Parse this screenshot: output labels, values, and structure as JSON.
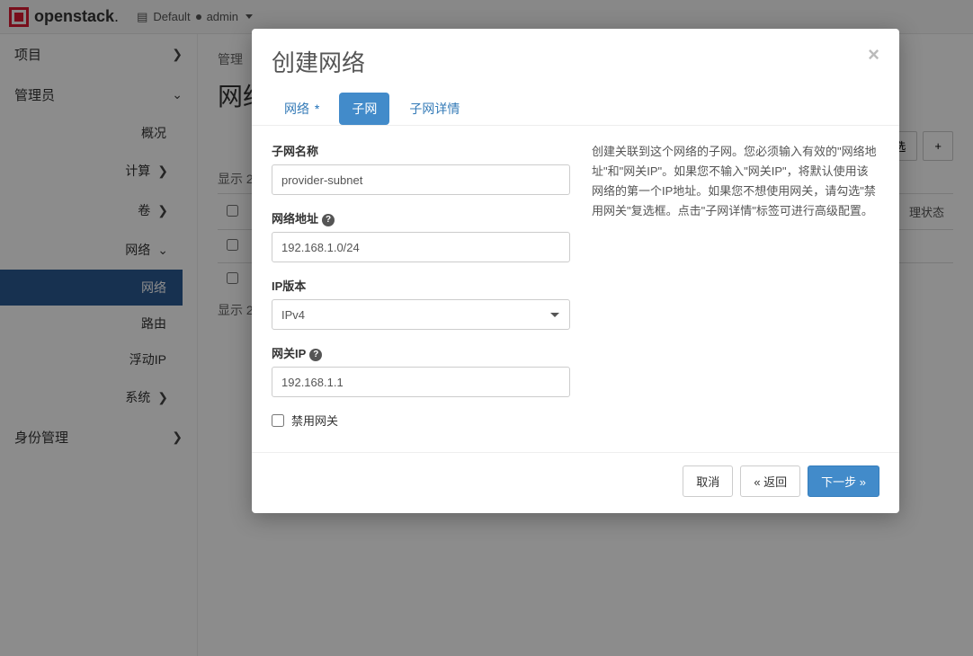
{
  "topbar": {
    "brand": "openstack",
    "domain_label": "Default",
    "user": "admin"
  },
  "sidebar": {
    "project": "项目",
    "admin": "管理员",
    "overview": "概况",
    "compute": "计算",
    "volume": "卷",
    "network": "网络",
    "network_item": "网络",
    "router": "路由",
    "floating_ip": "浮动IP",
    "system": "系统",
    "identity": "身份管理"
  },
  "main": {
    "breadcrumb": "管理",
    "title": "网络",
    "filter_btn": "筛选",
    "count_top": "显示 2",
    "count_bottom": "显示 2",
    "th_status": "理状态"
  },
  "modal": {
    "title": "创建网络",
    "tabs": {
      "network": "网络",
      "subnet": "子网",
      "detail": "子网详情"
    },
    "form": {
      "subnet_name_label": "子网名称",
      "subnet_name_value": "provider-subnet",
      "net_addr_label": "网络地址",
      "net_addr_value": "192.168.1.0/24",
      "ip_ver_label": "IP版本",
      "ip_ver_value": "IPv4",
      "gw_label": "网关IP",
      "gw_value": "192.168.1.1",
      "disable_gw": "禁用网关"
    },
    "help": "创建关联到这个网络的子网。您必须输入有效的\"网络地址\"和\"网关IP\"。如果您不输入\"网关IP\"，将默认使用该网络的第一个IP地址。如果您不想使用网关，请勾选\"禁用网关\"复选框。点击\"子网详情\"标签可进行高级配置。",
    "footer": {
      "cancel": "取消",
      "back": "« 返回",
      "next": "下一步 »"
    }
  }
}
